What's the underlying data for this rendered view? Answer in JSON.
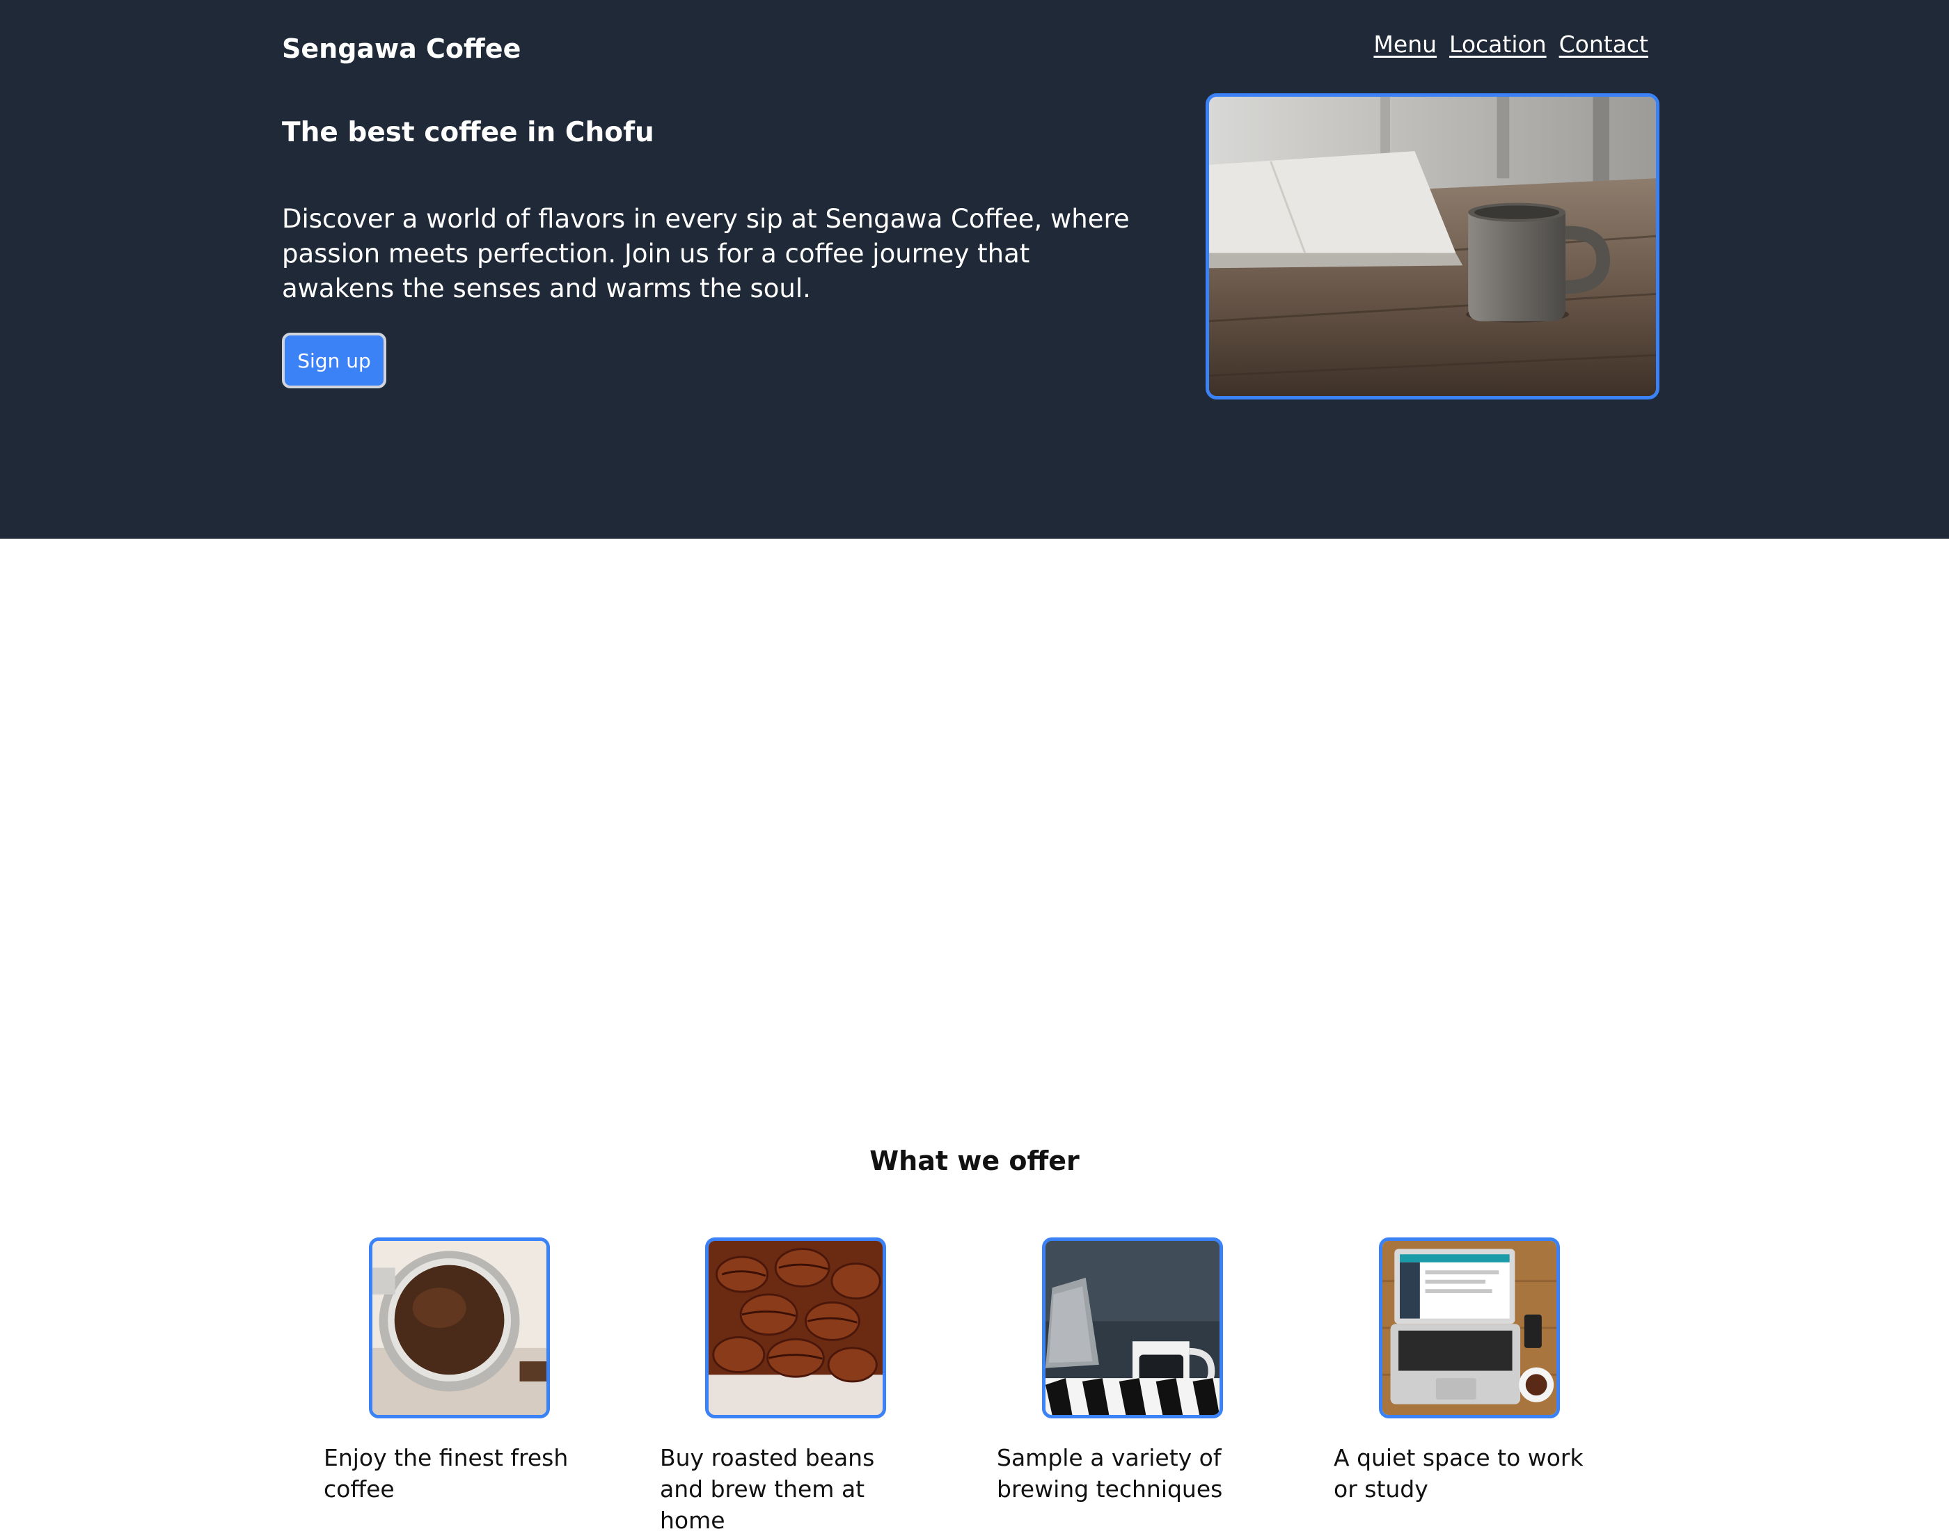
{
  "header": {
    "brand": "Sengawa Coffee",
    "nav": [
      "Menu",
      "Location",
      "Contact"
    ]
  },
  "hero": {
    "tagline": "The best coffee in Chofu",
    "description": "Discover a world of flavors in every sip at Sengawa Coffee, where passion meets perfection. Join us for a coffee journey that awakens the senses and warms the soul.",
    "signup_label": "Sign up",
    "image_alt": "coffee cup on rustic wooden table next to an open notebook"
  },
  "offer": {
    "title": "What we offer",
    "items": [
      {
        "caption": "Enjoy the finest fresh coffee",
        "image": "ground-coffee-portafilter"
      },
      {
        "caption": "Buy roasted beans and brew them at home",
        "image": "roasted-coffee-beans"
      },
      {
        "caption": "Sample a variety of brewing techniques",
        "image": "moka-pot-and-coffee-mug"
      },
      {
        "caption": "A quiet space to work or study",
        "image": "laptop-on-desk"
      }
    ]
  },
  "colors": {
    "hero_background": "#1f2937",
    "accent": "#3b82f6",
    "page_background": "#ffffff"
  }
}
